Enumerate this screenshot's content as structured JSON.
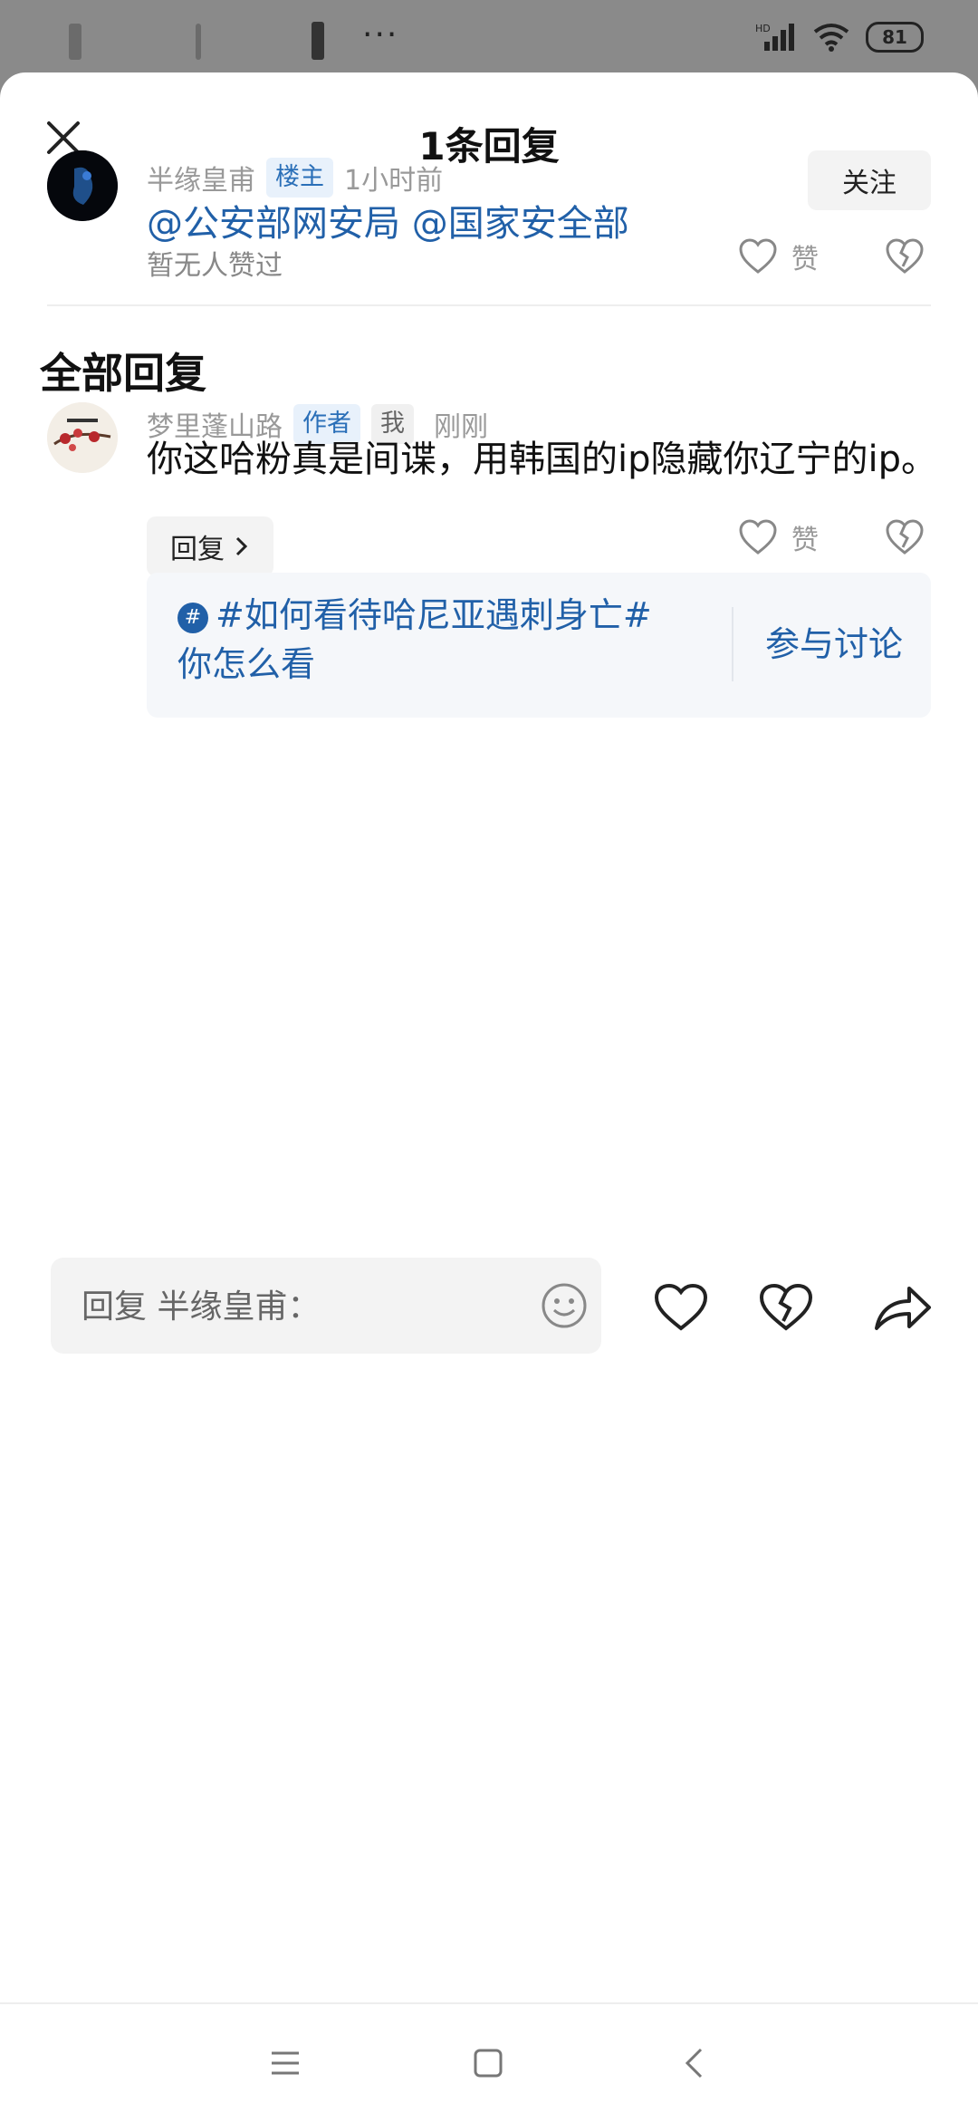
{
  "status_bar": {
    "battery": "81",
    "network": "HD"
  },
  "header": {
    "title": "1条回复"
  },
  "original_post": {
    "author": "半缘皇甫",
    "author_tag": "楼主",
    "time": "1小时前",
    "follow_label": "关注",
    "content": "@公安部网安局 @国家安全部",
    "likes_text": "暂无人赞过",
    "like_label": "赞"
  },
  "section_title": "全部回复",
  "reply": {
    "author": "梦里蓬山路",
    "tag_author": "作者",
    "tag_me": "我",
    "time": "刚刚",
    "content": "你这哈粉真是间谍，用韩国的ip隐藏你辽宁的ip。",
    "reply_label": "回复",
    "like_label": "赞"
  },
  "topic": {
    "text": "#如何看待哈尼亚遇刺身亡#你怎么看",
    "join_label": "参与讨论"
  },
  "input": {
    "placeholder": "回复 半缘皇甫："
  }
}
